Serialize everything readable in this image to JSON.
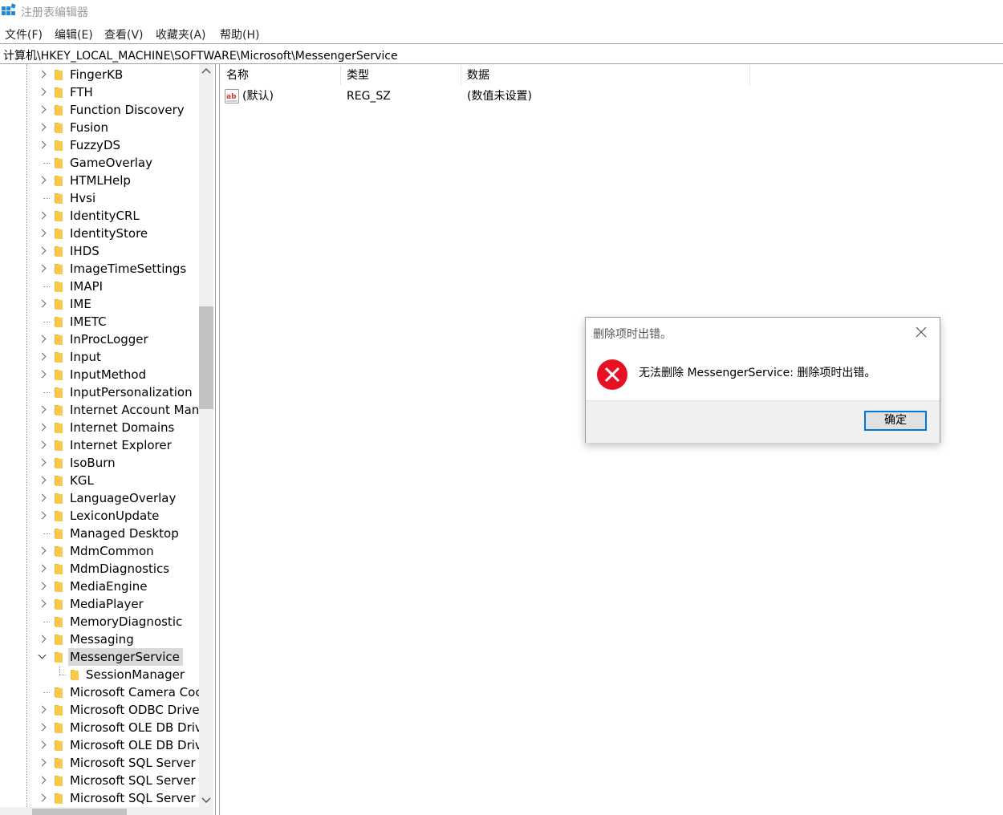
{
  "window": {
    "title": "注册表编辑器"
  },
  "menu": [
    "文件(F)",
    "编辑(E)",
    "查看(V)",
    "收藏夹(A)",
    "帮助(H)"
  ],
  "address": "计算机\\HKEY_LOCAL_MACHINE\\SOFTWARE\\Microsoft\\MessengerService",
  "tree": {
    "items": [
      {
        "label": "FingerKB",
        "state": "collapsed",
        "depth": 0
      },
      {
        "label": "FTH",
        "state": "collapsed",
        "depth": 0
      },
      {
        "label": "Function Discovery",
        "state": "collapsed",
        "depth": 0
      },
      {
        "label": "Fusion",
        "state": "collapsed",
        "depth": 0
      },
      {
        "label": "FuzzyDS",
        "state": "collapsed",
        "depth": 0
      },
      {
        "label": "GameOverlay",
        "state": "leaf",
        "depth": 0
      },
      {
        "label": "HTMLHelp",
        "state": "collapsed",
        "depth": 0
      },
      {
        "label": "Hvsi",
        "state": "leaf",
        "depth": 0
      },
      {
        "label": "IdentityCRL",
        "state": "collapsed",
        "depth": 0
      },
      {
        "label": "IdentityStore",
        "state": "collapsed",
        "depth": 0
      },
      {
        "label": "IHDS",
        "state": "collapsed",
        "depth": 0
      },
      {
        "label": "ImageTimeSettings",
        "state": "collapsed",
        "depth": 0
      },
      {
        "label": "IMAPI",
        "state": "leaf",
        "depth": 0
      },
      {
        "label": "IME",
        "state": "collapsed",
        "depth": 0
      },
      {
        "label": "IMETC",
        "state": "leaf",
        "depth": 0
      },
      {
        "label": "InProcLogger",
        "state": "collapsed",
        "depth": 0
      },
      {
        "label": "Input",
        "state": "collapsed",
        "depth": 0
      },
      {
        "label": "InputMethod",
        "state": "collapsed",
        "depth": 0
      },
      {
        "label": "InputPersonalization",
        "state": "leaf",
        "depth": 0
      },
      {
        "label": "Internet Account Man",
        "state": "collapsed",
        "depth": 0
      },
      {
        "label": "Internet Domains",
        "state": "collapsed",
        "depth": 0
      },
      {
        "label": "Internet Explorer",
        "state": "collapsed",
        "depth": 0
      },
      {
        "label": "IsoBurn",
        "state": "collapsed",
        "depth": 0
      },
      {
        "label": "KGL",
        "state": "collapsed",
        "depth": 0
      },
      {
        "label": "LanguageOverlay",
        "state": "collapsed",
        "depth": 0
      },
      {
        "label": "LexiconUpdate",
        "state": "collapsed",
        "depth": 0
      },
      {
        "label": "Managed Desktop",
        "state": "leaf",
        "depth": 0
      },
      {
        "label": "MdmCommon",
        "state": "collapsed",
        "depth": 0
      },
      {
        "label": "MdmDiagnostics",
        "state": "collapsed",
        "depth": 0
      },
      {
        "label": "MediaEngine",
        "state": "collapsed",
        "depth": 0
      },
      {
        "label": "MediaPlayer",
        "state": "collapsed",
        "depth": 0
      },
      {
        "label": "MemoryDiagnostic",
        "state": "leaf",
        "depth": 0
      },
      {
        "label": "Messaging",
        "state": "collapsed",
        "depth": 0
      },
      {
        "label": "MessengerService",
        "state": "expanded",
        "depth": 0,
        "selected": true
      },
      {
        "label": "SessionManager",
        "state": "leaf",
        "depth": 1
      },
      {
        "label": "Microsoft Camera Coc",
        "state": "leaf",
        "depth": 0
      },
      {
        "label": "Microsoft ODBC Drive",
        "state": "collapsed",
        "depth": 0
      },
      {
        "label": "Microsoft OLE DB Driv",
        "state": "collapsed",
        "depth": 0
      },
      {
        "label": "Microsoft OLE DB Driv",
        "state": "collapsed",
        "depth": 0
      },
      {
        "label": "Microsoft SQL Server",
        "state": "collapsed",
        "depth": 0
      },
      {
        "label": "Microsoft SQL Server",
        "state": "collapsed",
        "depth": 0
      },
      {
        "label": "Microsoft SQL Server",
        "state": "collapsed",
        "depth": 0
      }
    ]
  },
  "list": {
    "columns": [
      "名称",
      "类型",
      "数据"
    ],
    "rows": [
      {
        "name": "(默认)",
        "type": "REG_SZ",
        "data": "(数值未设置)",
        "icon": "string-value-icon"
      }
    ]
  },
  "dialog": {
    "title": "删除项时出错。",
    "message": "无法删除 MessengerService: 删除项时出错。",
    "ok_label": "确定",
    "icon": "error-icon"
  },
  "colors": {
    "accent": "#0078d7",
    "error": "#e81123",
    "folder": "#f8c94a",
    "selection": "#d9d9d9"
  }
}
